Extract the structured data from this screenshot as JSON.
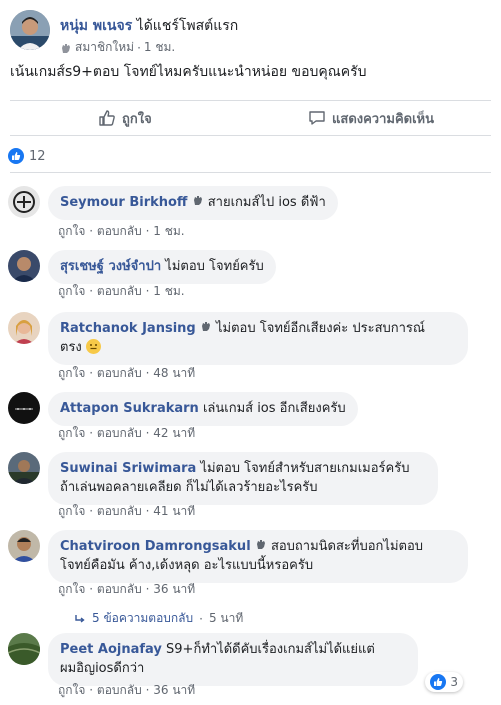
{
  "post": {
    "author": "หนุ่ม พเนจร",
    "activity": "ได้แชร์โพสต์แรก",
    "member_badge": "สมาชิกใหม่",
    "time": "1 ชม.",
    "text": "เน้นเกมส์s9+ตอบ โจทย์ไหมครับแนะนำหน่อย ขอบคุณครับ",
    "like_label": "ถูกใจ",
    "comment_label": "แสดงความคิดเห็น",
    "reaction_count": "12"
  },
  "labels": {
    "like": "ถูกใจ",
    "reply": "ตอบกลับ",
    "separator": "·"
  },
  "comments": [
    {
      "name": "Seymour Birkhoff",
      "text": "สายเกมส์ไป ios ดีฟ้า",
      "time": "1 ชม."
    },
    {
      "name": "สุรเชษฐ์ วงษ์จำปา",
      "text": "ไม่ตอบ โจทย์ครับ",
      "time": "1 ชม."
    },
    {
      "name": "Ratchanok Jansing",
      "text": "ไม่ตอบ โจทย์อีกเสียงค่ะ ประสบการณ์",
      "text2": "ตรง",
      "time": "48 นาที"
    },
    {
      "name": "Attapon Sukrakarn",
      "text": "เล่นเกมส์ ios อีกเสียงครับ",
      "time": "42 นาที"
    },
    {
      "name": "Suwinai Sriwimara",
      "text": "ไม่ตอบ โจทย์สำหรับสายเกมเมอร์ครับ",
      "text2": "ถ้าเล่นพอคลายเคลียด ก็ไม่ได้เลวร้ายอะไรครับ",
      "time": "41 นาที"
    },
    {
      "name": "Chatviroon Damrongsakul",
      "text": "สอบถามนิดสะที่บอกไม่ตอบ",
      "text2": "โจทย์คือมัน ค้าง,เด้งหลุด อะไรแบบนี้หรอครับ",
      "time": "36 นาที"
    },
    {
      "name": "Peet Aojnafay",
      "text": "S9+ก็ทำได้ดีคับเรื่องเกมส์ไม่ได้แย่แต่",
      "text2": "ผมอิญiosดีกว่า",
      "time": "36 นาที",
      "likes": "3"
    }
  ],
  "replies": {
    "label": "5 ข้อความตอบกลับ",
    "time": "5 นาที"
  },
  "colors": {
    "name_blue": "#385898",
    "like_blue": "#1877f2",
    "bubble_gray": "#f2f3f5",
    "meta_gray": "#616770"
  }
}
